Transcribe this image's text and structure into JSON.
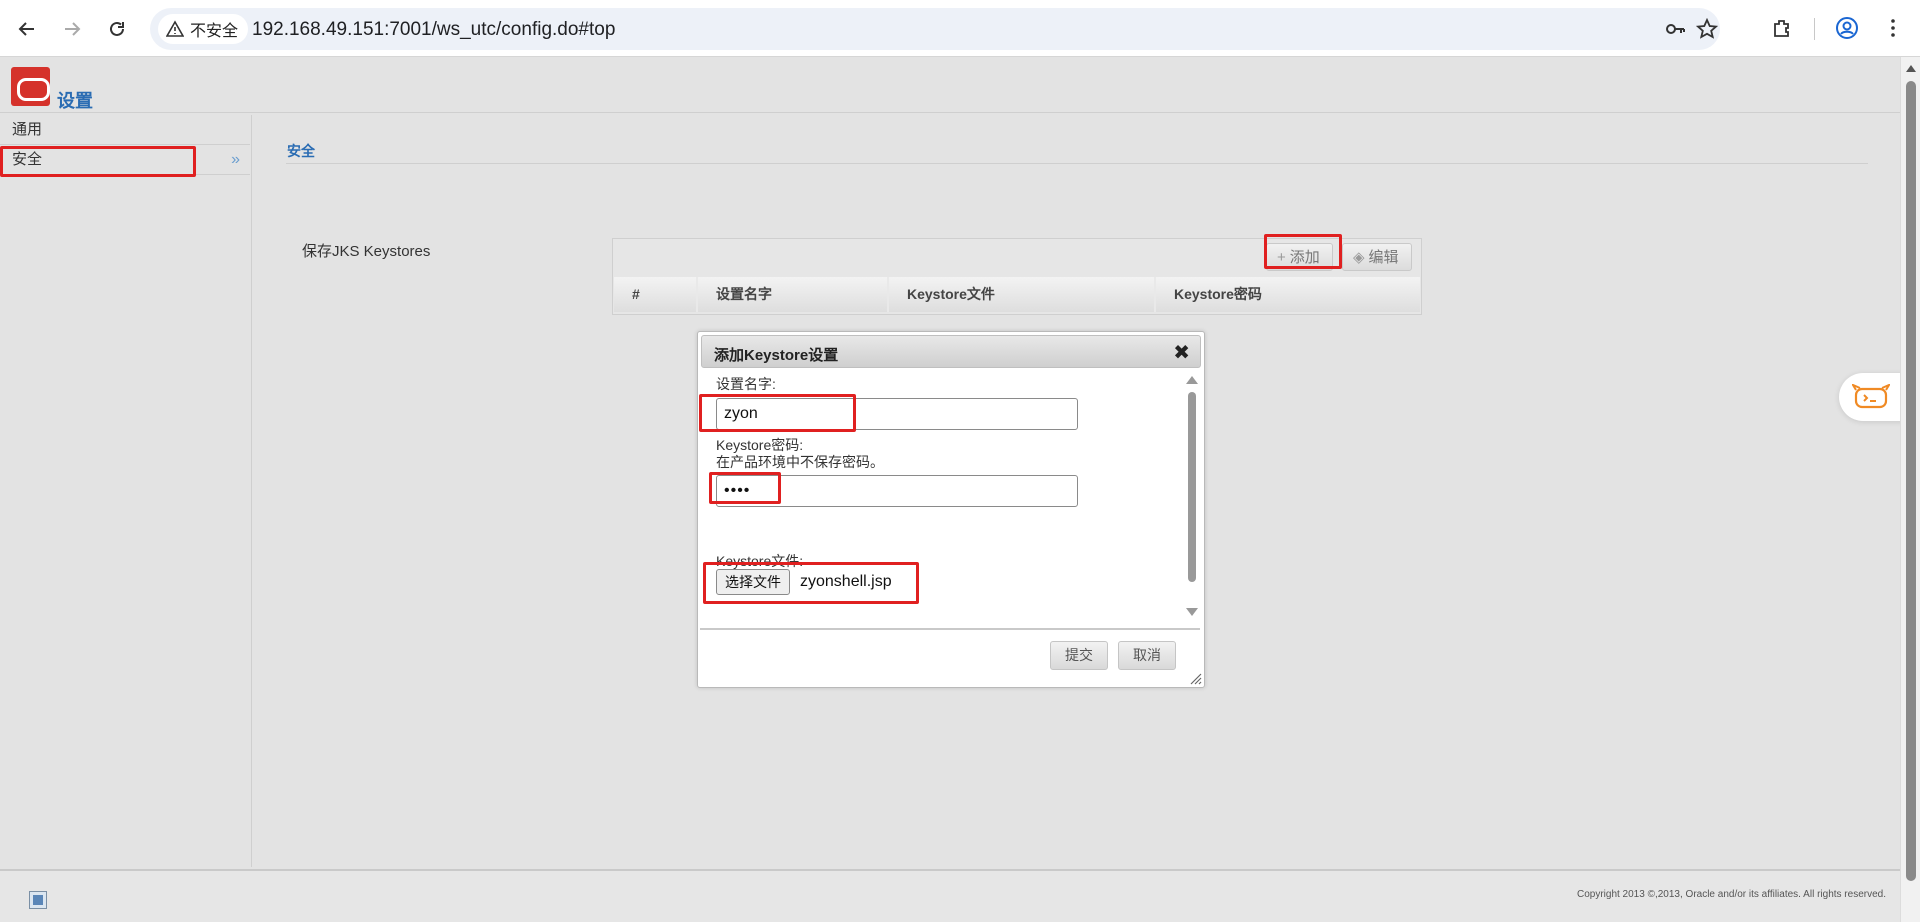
{
  "browser": {
    "security_label": "不安全",
    "url": "192.168.49.151:7001/ws_utc/config.do#top"
  },
  "app": {
    "title": "设置"
  },
  "sidebar": {
    "items": [
      {
        "label": "通用"
      },
      {
        "label": "安全"
      }
    ]
  },
  "content": {
    "section_title": "安全",
    "field_label": "保存JKS Keystores",
    "toolbar": {
      "add_label": "添加",
      "edit_label": "编辑"
    },
    "table": {
      "headers": [
        "#",
        "设置名字",
        "Keystore文件",
        "Keystore密码"
      ]
    }
  },
  "dialog": {
    "title": "添加Keystore设置",
    "name_label": "设置名字:",
    "name_value": "zyon",
    "password_label": "Keystore密码:",
    "password_hint": "在产品环境中不保存密码。",
    "password_value": "••••",
    "file_label": "Keystore文件:",
    "choose_file_label": "选择文件",
    "file_name": "zyonshell.jsp",
    "submit_label": "提交",
    "cancel_label": "取消"
  },
  "footer": {
    "copyright": "Copyright 2013 ©,2013, Oracle and/or its affiliates. All rights reserved."
  },
  "colors": {
    "accent": "#2a6cb3",
    "annotation": "#e02020",
    "logo": "#d5322b"
  }
}
